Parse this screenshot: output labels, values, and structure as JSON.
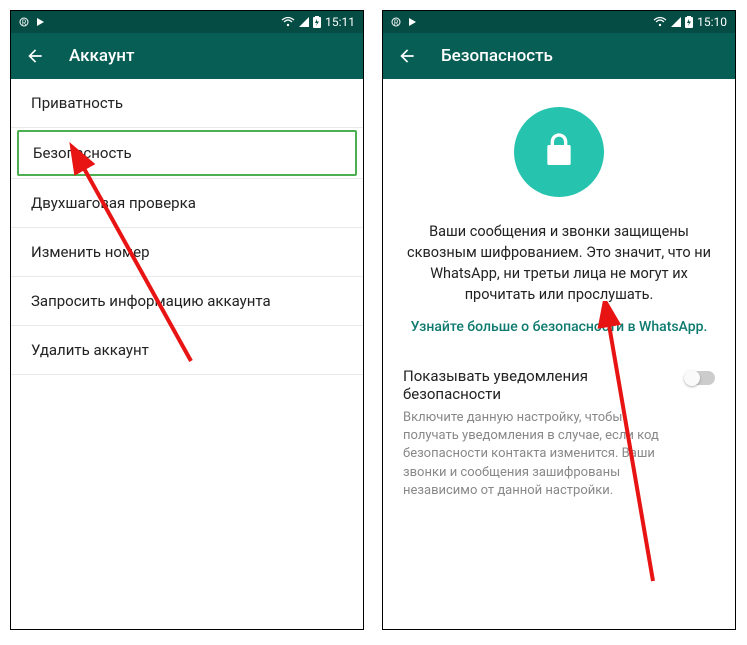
{
  "status": {
    "time": "15:10",
    "time2": "15:11"
  },
  "left": {
    "title": "Аккаунт",
    "items": [
      "Приватность",
      "Безопасность",
      "Двухшаговая проверка",
      "Изменить номер",
      "Запросить информацию аккаунта",
      "Удалить аккаунт"
    ]
  },
  "right": {
    "title": "Безопасность",
    "desc": "Ваши сообщения и звонки защищены сквозным шифрованием. Это значит, что ни WhatsApp, ни третьи лица не могут их прочитать или прослушать.",
    "link": "Узнайте больше о безопасности в WhatsApp.",
    "setting_title": "Показывать уведомления безопасности",
    "setting_sub": "Включите данную настройку, чтобы получать уведомления в случае, если код безопасности контакта изменится. Ваши звонки и сообщения зашифрованы независимо от данной настройки."
  }
}
